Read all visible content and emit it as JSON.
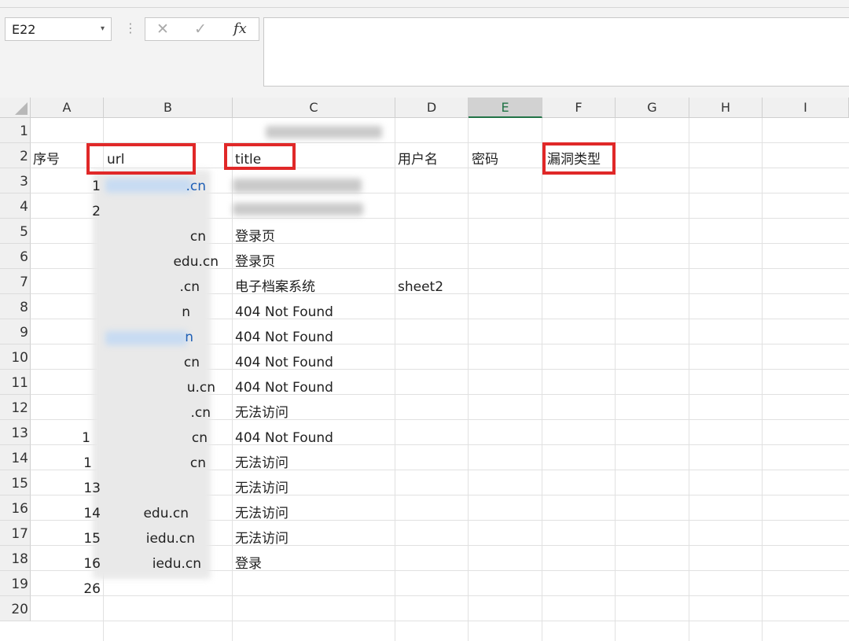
{
  "formula_bar": {
    "name_box": "E22",
    "cancel_symbol": "✕",
    "enter_symbol": "✓",
    "fx_label": "fx",
    "content": ""
  },
  "columns": [
    "A",
    "B",
    "C",
    "D",
    "E",
    "F",
    "G",
    "H",
    "I"
  ],
  "selected_column": "E",
  "rows": [
    "1",
    "2",
    "3",
    "4",
    "5",
    "6",
    "7",
    "8",
    "9",
    "10",
    "11",
    "12",
    "13",
    "14",
    "15",
    "16",
    "17",
    "18",
    "19",
    "20"
  ],
  "headers": {
    "seq": "序号",
    "url": "url",
    "title": "title",
    "username": "用户名",
    "password": "密码",
    "vuln_type": "漏洞类型"
  },
  "data_rows": [
    {
      "seq": "1",
      "url_tail": ".cn",
      "title": ""
    },
    {
      "seq": "2",
      "url_tail": "",
      "title": ""
    },
    {
      "seq": "",
      "url_tail": "cn",
      "title": "登录页"
    },
    {
      "seq": "",
      "url_tail": "edu.cn",
      "title": "登录页"
    },
    {
      "seq": "",
      "url_tail": ".cn",
      "title": "电子档案系统",
      "d": "sheet2"
    },
    {
      "seq": "",
      "url_tail": "n",
      "title": "404 Not Found"
    },
    {
      "seq": "",
      "url_tail": "n",
      "title": "404 Not Found"
    },
    {
      "seq": "",
      "url_tail": "cn",
      "title": "404 Not Found"
    },
    {
      "seq": "",
      "url_tail": "u.cn",
      "title": "404 Not Found"
    },
    {
      "seq": "",
      "url_tail": ".cn",
      "title": "无法访问"
    },
    {
      "seq": "1",
      "url_tail": "cn",
      "title": "404 Not Found"
    },
    {
      "seq": "1",
      "url_tail": "cn",
      "title": "无法访问"
    },
    {
      "seq": "13",
      "url_tail": "",
      "title": "无法访问"
    },
    {
      "seq": "14",
      "url_tail": "edu.cn",
      "title": "无法访问"
    },
    {
      "seq": "15",
      "url_tail": "iedu.cn",
      "title": "无法访问"
    },
    {
      "seq": "16",
      "url_tail": "iedu.cn",
      "title": "登录"
    },
    {
      "seq": "26",
      "url_tail": "",
      "title": ""
    }
  ],
  "colors": {
    "highlight_box": "#e02828",
    "selected_header": "#217346",
    "link": "#1f5fb5"
  }
}
